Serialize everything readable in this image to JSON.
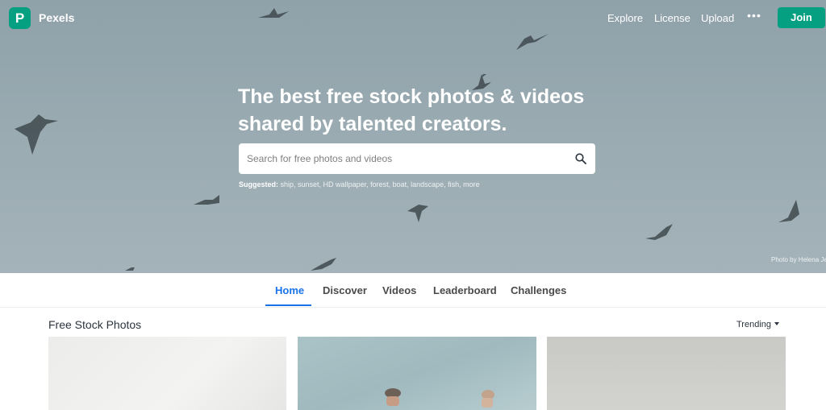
{
  "topbar": {
    "brand": "Pexels",
    "logo_letter": "P",
    "nav": [
      "Explore",
      "License",
      "Upload"
    ],
    "more_icon": "ellipsis-icon",
    "join_label": "Join"
  },
  "hero": {
    "headline_line1": "The best free stock photos & videos",
    "headline_line2": "shared by talented creators.",
    "search_placeholder": "Search for free photos and videos",
    "search_icon": "search-icon",
    "suggested_label": "Suggested:",
    "suggested_items": "ship, sunset, HD wallpaper, forest, boat, landscape, fish, more",
    "photo_credit": "Photo by Helena Je"
  },
  "tabs": {
    "items": [
      "Home",
      "Discover",
      "Videos",
      "Leaderboard",
      "Challenges"
    ],
    "active": "Home"
  },
  "feed": {
    "title": "Free Stock Photos",
    "sort_label": "Trending"
  },
  "colors": {
    "brand": "#05a081",
    "active_tab": "#1a73e8"
  }
}
